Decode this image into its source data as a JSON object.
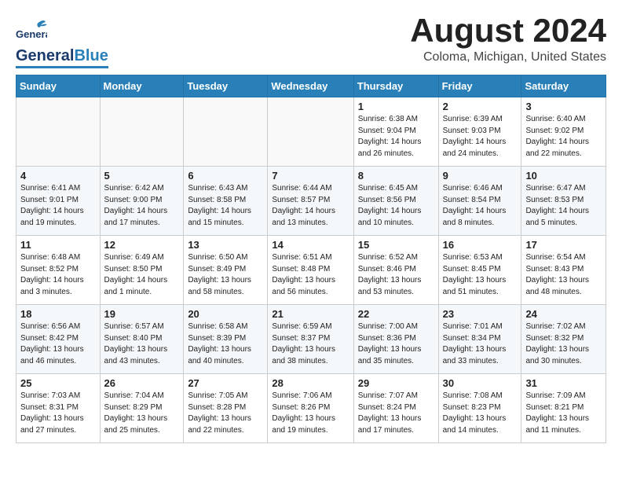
{
  "header": {
    "logo_general": "General",
    "logo_blue": "Blue",
    "month_title": "August 2024",
    "location": "Coloma, Michigan, United States"
  },
  "weekdays": [
    "Sunday",
    "Monday",
    "Tuesday",
    "Wednesday",
    "Thursday",
    "Friday",
    "Saturday"
  ],
  "weeks": [
    [
      {
        "day": "",
        "info": ""
      },
      {
        "day": "",
        "info": ""
      },
      {
        "day": "",
        "info": ""
      },
      {
        "day": "",
        "info": ""
      },
      {
        "day": "1",
        "info": "Sunrise: 6:38 AM\nSunset: 9:04 PM\nDaylight: 14 hours\nand 26 minutes."
      },
      {
        "day": "2",
        "info": "Sunrise: 6:39 AM\nSunset: 9:03 PM\nDaylight: 14 hours\nand 24 minutes."
      },
      {
        "day": "3",
        "info": "Sunrise: 6:40 AM\nSunset: 9:02 PM\nDaylight: 14 hours\nand 22 minutes."
      }
    ],
    [
      {
        "day": "4",
        "info": "Sunrise: 6:41 AM\nSunset: 9:01 PM\nDaylight: 14 hours\nand 19 minutes."
      },
      {
        "day": "5",
        "info": "Sunrise: 6:42 AM\nSunset: 9:00 PM\nDaylight: 14 hours\nand 17 minutes."
      },
      {
        "day": "6",
        "info": "Sunrise: 6:43 AM\nSunset: 8:58 PM\nDaylight: 14 hours\nand 15 minutes."
      },
      {
        "day": "7",
        "info": "Sunrise: 6:44 AM\nSunset: 8:57 PM\nDaylight: 14 hours\nand 13 minutes."
      },
      {
        "day": "8",
        "info": "Sunrise: 6:45 AM\nSunset: 8:56 PM\nDaylight: 14 hours\nand 10 minutes."
      },
      {
        "day": "9",
        "info": "Sunrise: 6:46 AM\nSunset: 8:54 PM\nDaylight: 14 hours\nand 8 minutes."
      },
      {
        "day": "10",
        "info": "Sunrise: 6:47 AM\nSunset: 8:53 PM\nDaylight: 14 hours\nand 5 minutes."
      }
    ],
    [
      {
        "day": "11",
        "info": "Sunrise: 6:48 AM\nSunset: 8:52 PM\nDaylight: 14 hours\nand 3 minutes."
      },
      {
        "day": "12",
        "info": "Sunrise: 6:49 AM\nSunset: 8:50 PM\nDaylight: 14 hours\nand 1 minute."
      },
      {
        "day": "13",
        "info": "Sunrise: 6:50 AM\nSunset: 8:49 PM\nDaylight: 13 hours\nand 58 minutes."
      },
      {
        "day": "14",
        "info": "Sunrise: 6:51 AM\nSunset: 8:48 PM\nDaylight: 13 hours\nand 56 minutes."
      },
      {
        "day": "15",
        "info": "Sunrise: 6:52 AM\nSunset: 8:46 PM\nDaylight: 13 hours\nand 53 minutes."
      },
      {
        "day": "16",
        "info": "Sunrise: 6:53 AM\nSunset: 8:45 PM\nDaylight: 13 hours\nand 51 minutes."
      },
      {
        "day": "17",
        "info": "Sunrise: 6:54 AM\nSunset: 8:43 PM\nDaylight: 13 hours\nand 48 minutes."
      }
    ],
    [
      {
        "day": "18",
        "info": "Sunrise: 6:56 AM\nSunset: 8:42 PM\nDaylight: 13 hours\nand 46 minutes."
      },
      {
        "day": "19",
        "info": "Sunrise: 6:57 AM\nSunset: 8:40 PM\nDaylight: 13 hours\nand 43 minutes."
      },
      {
        "day": "20",
        "info": "Sunrise: 6:58 AM\nSunset: 8:39 PM\nDaylight: 13 hours\nand 40 minutes."
      },
      {
        "day": "21",
        "info": "Sunrise: 6:59 AM\nSunset: 8:37 PM\nDaylight: 13 hours\nand 38 minutes."
      },
      {
        "day": "22",
        "info": "Sunrise: 7:00 AM\nSunset: 8:36 PM\nDaylight: 13 hours\nand 35 minutes."
      },
      {
        "day": "23",
        "info": "Sunrise: 7:01 AM\nSunset: 8:34 PM\nDaylight: 13 hours\nand 33 minutes."
      },
      {
        "day": "24",
        "info": "Sunrise: 7:02 AM\nSunset: 8:32 PM\nDaylight: 13 hours\nand 30 minutes."
      }
    ],
    [
      {
        "day": "25",
        "info": "Sunrise: 7:03 AM\nSunset: 8:31 PM\nDaylight: 13 hours\nand 27 minutes."
      },
      {
        "day": "26",
        "info": "Sunrise: 7:04 AM\nSunset: 8:29 PM\nDaylight: 13 hours\nand 25 minutes."
      },
      {
        "day": "27",
        "info": "Sunrise: 7:05 AM\nSunset: 8:28 PM\nDaylight: 13 hours\nand 22 minutes."
      },
      {
        "day": "28",
        "info": "Sunrise: 7:06 AM\nSunset: 8:26 PM\nDaylight: 13 hours\nand 19 minutes."
      },
      {
        "day": "29",
        "info": "Sunrise: 7:07 AM\nSunset: 8:24 PM\nDaylight: 13 hours\nand 17 minutes."
      },
      {
        "day": "30",
        "info": "Sunrise: 7:08 AM\nSunset: 8:23 PM\nDaylight: 13 hours\nand 14 minutes."
      },
      {
        "day": "31",
        "info": "Sunrise: 7:09 AM\nSunset: 8:21 PM\nDaylight: 13 hours\nand 11 minutes."
      }
    ]
  ]
}
